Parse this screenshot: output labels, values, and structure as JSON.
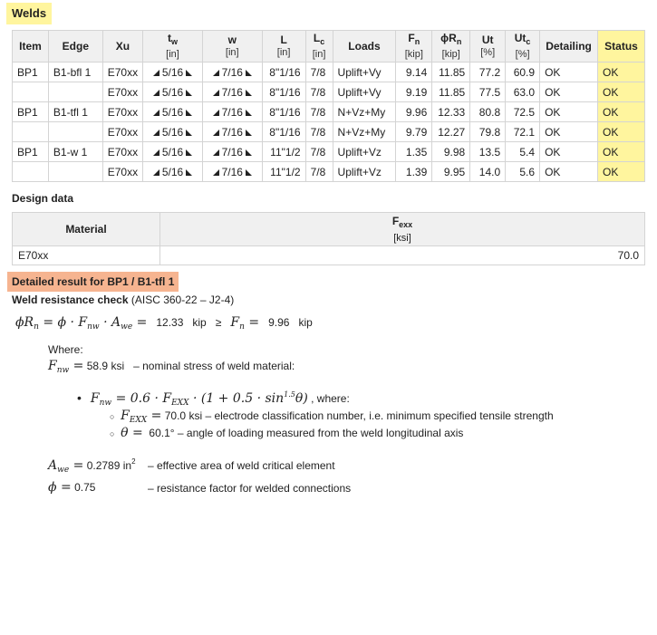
{
  "welds_section": {
    "title": "Welds",
    "headers": {
      "item": "Item",
      "edge": "Edge",
      "xu": "Xu",
      "tw": "t",
      "tw_sub": "w",
      "tw_unit": "[in]",
      "w": "w",
      "w_unit": "[in]",
      "L": "L",
      "L_unit": "[in]",
      "Lc": "L",
      "Lc_sub": "c",
      "Lc_unit": "[in]",
      "loads": "Loads",
      "fn": "F",
      "fn_sub": "n",
      "fn_unit": "[kip]",
      "phirn": "ϕR",
      "phirn_sub": "n",
      "phirn_unit": "[kip]",
      "ut": "Ut",
      "ut_unit": "[%]",
      "utc": "Ut",
      "utc_sub": "c",
      "utc_unit": "[%]",
      "detailing": "Detailing",
      "status": "Status"
    },
    "rows": [
      {
        "item": "BP1",
        "edge": "B1-bfl 1",
        "xu": "E70xx",
        "tw": "5/16",
        "w": "7/16",
        "L": "8\"1/16",
        "Lc": "7/8",
        "loads": "Uplift+Vy",
        "fn": "9.14",
        "phirn": "11.85",
        "ut": "77.2",
        "utc": "60.9",
        "detailing": "OK",
        "status": "OK"
      },
      {
        "item": "",
        "edge": "",
        "xu": "E70xx",
        "tw": "5/16",
        "w": "7/16",
        "L": "8\"1/16",
        "Lc": "7/8",
        "loads": "Uplift+Vy",
        "fn": "9.19",
        "phirn": "11.85",
        "ut": "77.5",
        "utc": "63.0",
        "detailing": "OK",
        "status": "OK"
      },
      {
        "item": "BP1",
        "edge": "B1-tfl 1",
        "xu": "E70xx",
        "tw": "5/16",
        "w": "7/16",
        "L": "8\"1/16",
        "Lc": "7/8",
        "loads": "N+Vz+My",
        "fn": "9.96",
        "phirn": "12.33",
        "ut": "80.8",
        "utc": "72.5",
        "detailing": "OK",
        "status": "OK"
      },
      {
        "item": "",
        "edge": "",
        "xu": "E70xx",
        "tw": "5/16",
        "w": "7/16",
        "L": "8\"1/16",
        "Lc": "7/8",
        "loads": "N+Vz+My",
        "fn": "9.79",
        "phirn": "12.27",
        "ut": "79.8",
        "utc": "72.1",
        "detailing": "OK",
        "status": "OK"
      },
      {
        "item": "BP1",
        "edge": "B1-w 1",
        "xu": "E70xx",
        "tw": "5/16",
        "w": "7/16",
        "L": "11\"1/2",
        "Lc": "7/8",
        "loads": "Uplift+Vz",
        "fn": "1.35",
        "phirn": "9.98",
        "ut": "13.5",
        "utc": "5.4",
        "detailing": "OK",
        "status": "OK"
      },
      {
        "item": "",
        "edge": "",
        "xu": "E70xx",
        "tw": "5/16",
        "w": "7/16",
        "L": "11\"1/2",
        "Lc": "7/8",
        "loads": "Uplift+Vz",
        "fn": "1.39",
        "phirn": "9.95",
        "ut": "14.0",
        "utc": "5.6",
        "detailing": "OK",
        "status": "OK"
      }
    ]
  },
  "design_data": {
    "title": "Design data",
    "material_header": "Material",
    "fexx_header": "F",
    "fexx_sub": "exx",
    "fexx_unit": "[ksi]",
    "material": "E70xx",
    "fexx": "70.0"
  },
  "detail": {
    "title": "Detailed result for BP1 / B1-tfl 1",
    "check_title": "Weld resistance check",
    "check_ref": "(AISC 360-22 – J2-4)",
    "phirn_value": "12.33",
    "phirn_unit": "kip",
    "geq": "≥",
    "fn_value": "9.96",
    "fn_unit": "kip",
    "where": "Where:",
    "fnw_value": "58.9 ksi",
    "fnw_desc": "– nominal stress of weld material:",
    "where2": ", where:",
    "fexx_value": "70.0 ksi",
    "fexx_desc": "– electrode classification number, i.e. minimum specified tensile strength",
    "theta_value": "60.1°",
    "theta_desc": "– angle of loading measured from the weld longitudinal axis",
    "awe_value": "0.2789 in",
    "awe_exp": "2",
    "awe_desc": "– effective area of weld critical element",
    "phi_value": "0.75",
    "phi_desc": "– resistance factor for welded connections"
  },
  "colors": {
    "highlight_yellow": "#fff59e",
    "highlight_orange": "#f6b490",
    "header_bg": "#f0f0f0"
  }
}
